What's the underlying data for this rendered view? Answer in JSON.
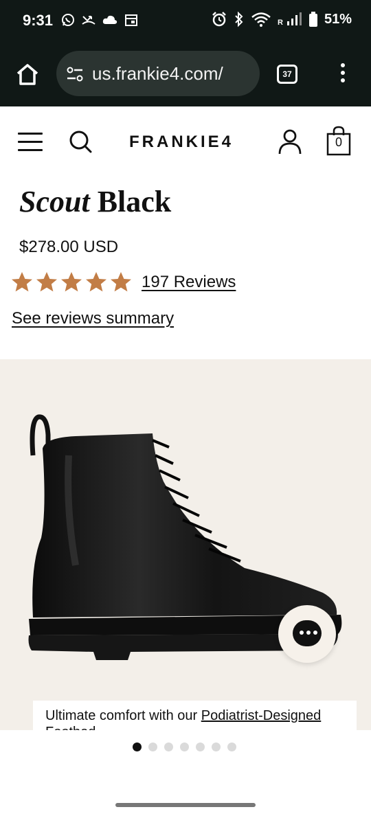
{
  "status_bar": {
    "time": "9:31",
    "battery": "51%",
    "left_icons": [
      "whatsapp-icon",
      "missed-call-icon",
      "cloud-icon",
      "calendar-icon"
    ],
    "right_icons": [
      "alarm-icon",
      "bluetooth-icon",
      "wifi-icon",
      "signal-icon",
      "battery-icon"
    ]
  },
  "browser": {
    "url": "us.frankie4.com/",
    "tab_count": "37"
  },
  "header": {
    "logo": "FRANKIE4",
    "bag_count": "0"
  },
  "product": {
    "title_italic": "Scout",
    "title_rest": " Black",
    "price": "$278.00 USD",
    "rating_stars": 5,
    "reviews_label": "197 Reviews",
    "summary_link": "See reviews summary",
    "banner_text": "Ultimate comfort with our ",
    "banner_link": "Podiatrist-Designed Footbed"
  },
  "carousel": {
    "total_slides": 7,
    "active_index": 0
  },
  "colors": {
    "star": "#c27d46",
    "chrome_bg": "#101816",
    "url_pill": "#2b3431",
    "image_bg": "#f3efe9"
  }
}
